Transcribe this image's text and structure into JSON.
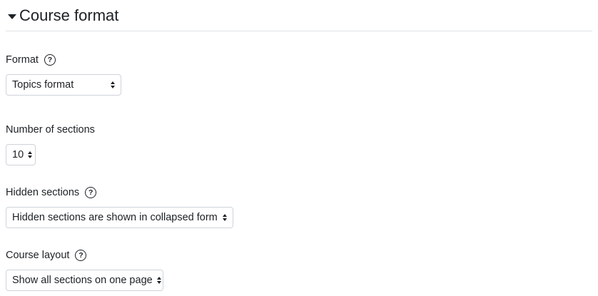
{
  "section": {
    "title": "Course format"
  },
  "fields": {
    "format": {
      "label": "Format",
      "help": "?",
      "value": "Topics format"
    },
    "number_of_sections": {
      "label": "Number of sections",
      "value": "10"
    },
    "hidden_sections": {
      "label": "Hidden sections",
      "help": "?",
      "value": "Hidden sections are shown in collapsed form"
    },
    "course_layout": {
      "label": "Course layout",
      "help": "?",
      "value": "Show all sections on one page"
    }
  },
  "icons": {
    "collapse": "caret-down-icon",
    "help": "question-circle-icon",
    "select": "up-down-arrows-icon"
  }
}
